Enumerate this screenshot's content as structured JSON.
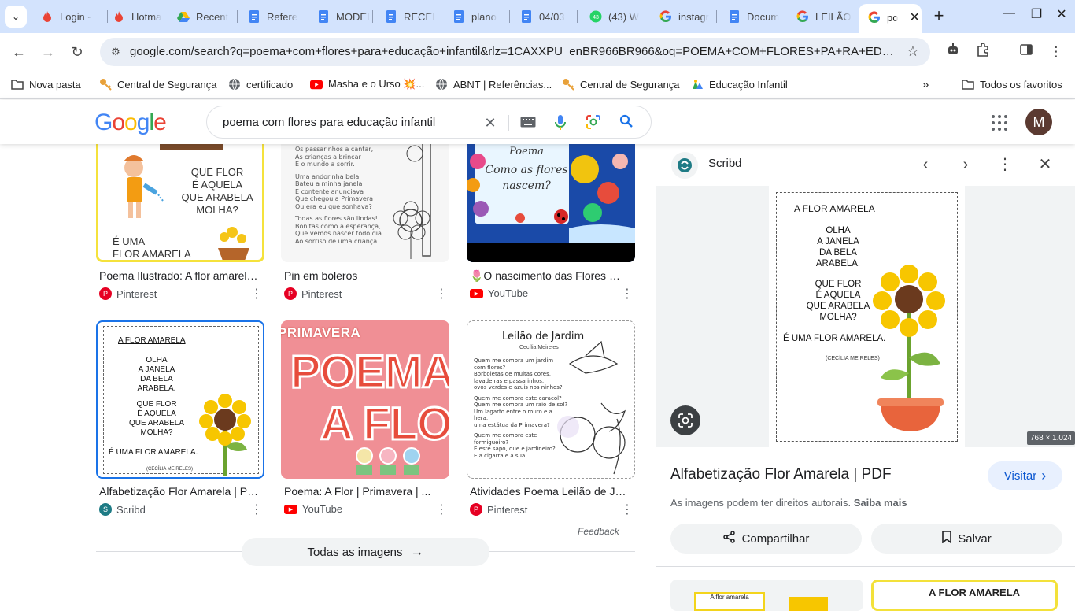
{
  "browser": {
    "tabs": [
      {
        "title": "Login -",
        "icon": "fire-icon"
      },
      {
        "title": "Hotma",
        "icon": "fire-icon"
      },
      {
        "title": "Recent",
        "icon": "drive-icon"
      },
      {
        "title": "Refere",
        "icon": "docs-icon"
      },
      {
        "title": "MODEL",
        "icon": "docs-icon"
      },
      {
        "title": "RECEI",
        "icon": "docs-icon"
      },
      {
        "title": "plano",
        "icon": "docs-icon"
      },
      {
        "title": "04/03",
        "icon": "docs-icon"
      },
      {
        "title": "(43) W",
        "icon": "whatsapp-icon",
        "badge": "43"
      },
      {
        "title": "instagr",
        "icon": "google-icon"
      },
      {
        "title": "Docum",
        "icon": "docs-icon"
      },
      {
        "title": "LEILÃO",
        "icon": "google-icon"
      },
      {
        "title": "po",
        "icon": "google-icon",
        "active": true
      }
    ],
    "url": "google.com/search?q=poema+com+flores+para+educação+infantil&rlz=1CAXXPU_enBR966BR966&oq=POEMA+COM+FLORES+PA+RA+EDUCAÇÃ...",
    "bookmarks": [
      {
        "label": "Nova pasta",
        "icon": "folder-icon"
      },
      {
        "label": "Central de Segurança",
        "icon": "key-icon"
      },
      {
        "label": "certificado",
        "icon": "globe-icon"
      },
      {
        "label": "Masha e o Urso 💥...",
        "icon": "youtube-icon"
      },
      {
        "label": "ABNT | Referências...",
        "icon": "globe-icon"
      },
      {
        "label": "Central de Segurança",
        "icon": "key-icon"
      },
      {
        "label": "Educação Infantil",
        "icon": "people-icon"
      }
    ],
    "all_bookmarks": "Todos os favoritos"
  },
  "google": {
    "logo": [
      "G",
      "o",
      "o",
      "g",
      "l",
      "e"
    ],
    "logo_colors": [
      "#4285f4",
      "#ea4335",
      "#fbbc05",
      "#4285f4",
      "#34a853",
      "#ea4335"
    ],
    "query": "poema com flores para educação infantil",
    "avatar_letter": "M"
  },
  "results": [
    {
      "title": "Poema Ilustrado: A flor amarela...",
      "source": "Pinterest",
      "src_icon": "pinterest-icon"
    },
    {
      "title": "Pin em boleros",
      "source": "Pinterest",
      "src_icon": "pinterest-icon"
    },
    {
      "title": "🌷O nascimento das Flores 🌷...",
      "source": "YouTube",
      "src_icon": "youtube-icon"
    },
    {
      "title": "Alfabetização Flor Amarela | PDF",
      "source": "Scribd",
      "src_icon": "scribd-icon"
    },
    {
      "title": "Poema: A Flor | Primavera | ...",
      "source": "YouTube",
      "src_icon": "youtube-icon"
    },
    {
      "title": "Atividades Poema Leilão de Jardim",
      "source": "Pinterest",
      "src_icon": "pinterest-icon"
    }
  ],
  "thumb_text": {
    "r1_poem_lines": [
      "QUE FLOR",
      "É AQUELA",
      "QUE ARABELA",
      "MOLHA?",
      "É UMA",
      "FLOR AMARELA"
    ],
    "r2_lines": [
      "Os passarinhos a cantar,",
      "As crianças a brincar",
      "E o mundo a sorrir.",
      "Uma andorinha bela",
      "Bateu a minha janela",
      "E contente anunciava",
      "Que chegou a Primavera",
      "Ou era eu que sonhava?",
      "Todas as flores são lindas!",
      "Bonitas como a esperança,",
      "Que vemos nascer todo dia",
      "Ao sorriso de uma criança."
    ],
    "r3_lines": [
      "Poema",
      "Como as flores",
      "nascem?"
    ],
    "r5_lines": [
      "PRIMAVERA",
      "POEMA",
      "A FLOR"
    ],
    "r6_title": "Leilão de Jardim",
    "r6_author": "Cecília Meireles",
    "r6_lines": [
      "Quem me compra um jardim",
      "com flores?",
      "Borboletas de muitas cores,",
      "lavadeiras e passarinhos,",
      "ovos verdes e azuis nos ninhos?",
      "Quem me compra este caracol?",
      "Quem me compra um raio de sol?",
      "Um lagarto entre o muro e a",
      "hera,",
      "uma estátua da Primavera?",
      "Quem me compra este",
      "formigueiro?",
      "E este sapo, que é jardineiro?",
      "E a cigarra e a sua"
    ]
  },
  "feedback": "Feedback",
  "all_images": "Todas as imagens",
  "panel": {
    "site": "Scribd",
    "image_text": {
      "heading": "A FLOR AMARELA",
      "lines": [
        "OLHA",
        "A JANELA",
        "DA BELA",
        "ARABELA.",
        "QUE FLOR",
        "É AQUELA",
        "QUE ARABELA",
        "MOLHA?",
        "É UMA FLOR AMARELA."
      ],
      "author": "(CECÍLIA MEIRELES)"
    },
    "dimensions": "768 × 1.024",
    "title": "Alfabetização Flor Amarela | PDF",
    "visit": "Visitar",
    "rights": "As imagens podem ter direitos autorais.",
    "learn_more": "Saiba mais",
    "share": "Compartilhar",
    "save": "Salvar",
    "related": [
      {
        "text": "A flor amarela"
      },
      {
        "text": "A FLOR AMARELA"
      }
    ]
  }
}
